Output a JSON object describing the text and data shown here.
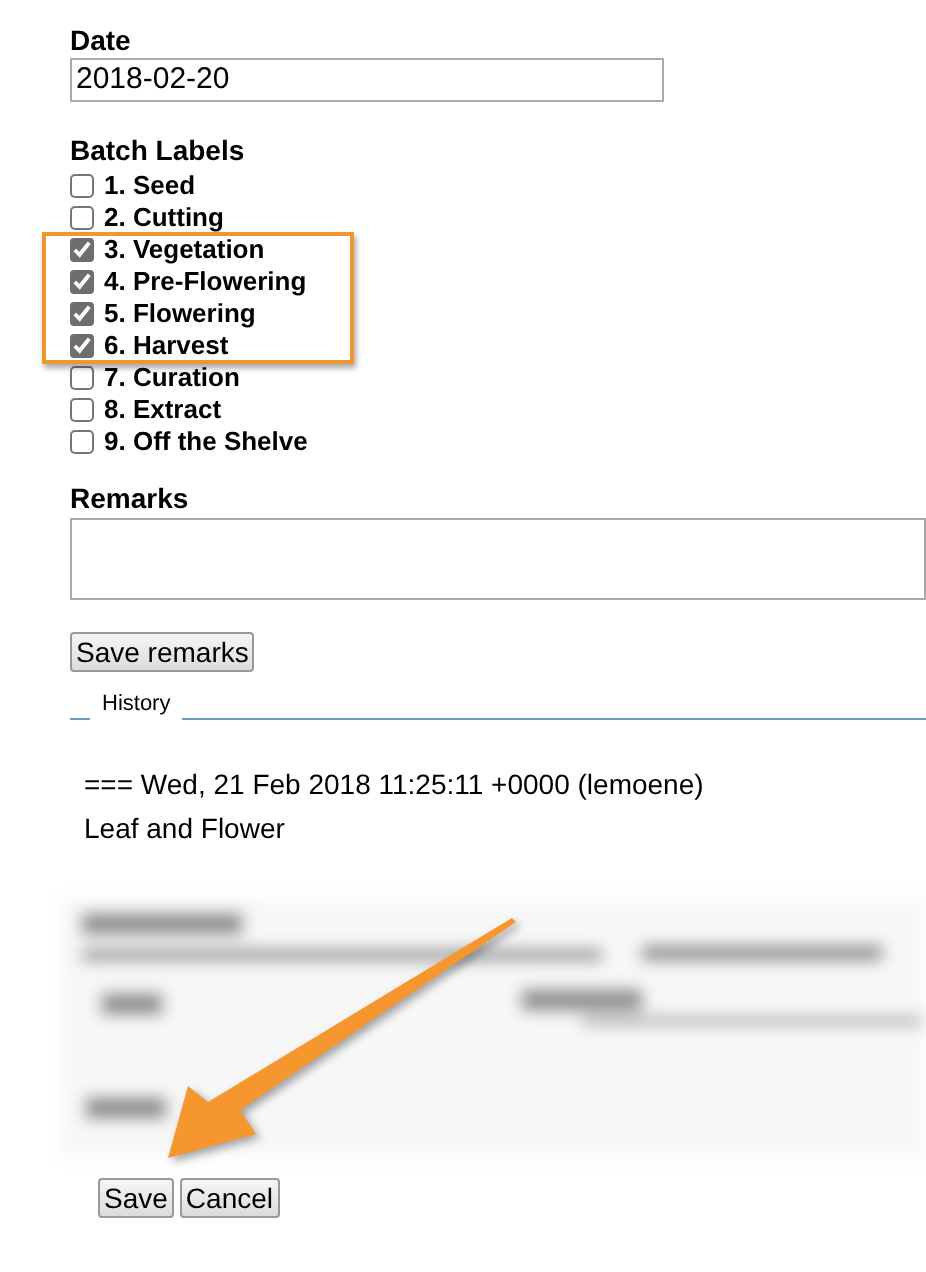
{
  "date": {
    "label": "Date",
    "value": "2018-02-20"
  },
  "batch_labels": {
    "label": "Batch Labels",
    "items": [
      {
        "label": "1. Seed",
        "checked": false,
        "highlighted": false
      },
      {
        "label": "2. Cutting",
        "checked": false,
        "highlighted": false
      },
      {
        "label": "3. Vegetation",
        "checked": true,
        "highlighted": true
      },
      {
        "label": "4. Pre-Flowering",
        "checked": true,
        "highlighted": true
      },
      {
        "label": "5. Flowering",
        "checked": true,
        "highlighted": true
      },
      {
        "label": "6. Harvest",
        "checked": true,
        "highlighted": true
      },
      {
        "label": "7. Curation",
        "checked": false,
        "highlighted": false
      },
      {
        "label": "8. Extract",
        "checked": false,
        "highlighted": false
      },
      {
        "label": "9. Off the Shelve",
        "checked": false,
        "highlighted": false
      }
    ]
  },
  "remarks": {
    "label": "Remarks",
    "button": "Save remarks"
  },
  "history": {
    "legend": "History",
    "entries": [
      "=== Wed, 21 Feb 2018 11:25:11 +0000 (lemoene)",
      "Leaf and Flower"
    ]
  },
  "blurred_section": true,
  "arrow_annotation": true,
  "buttons": [
    "Save",
    "Cancel"
  ]
}
